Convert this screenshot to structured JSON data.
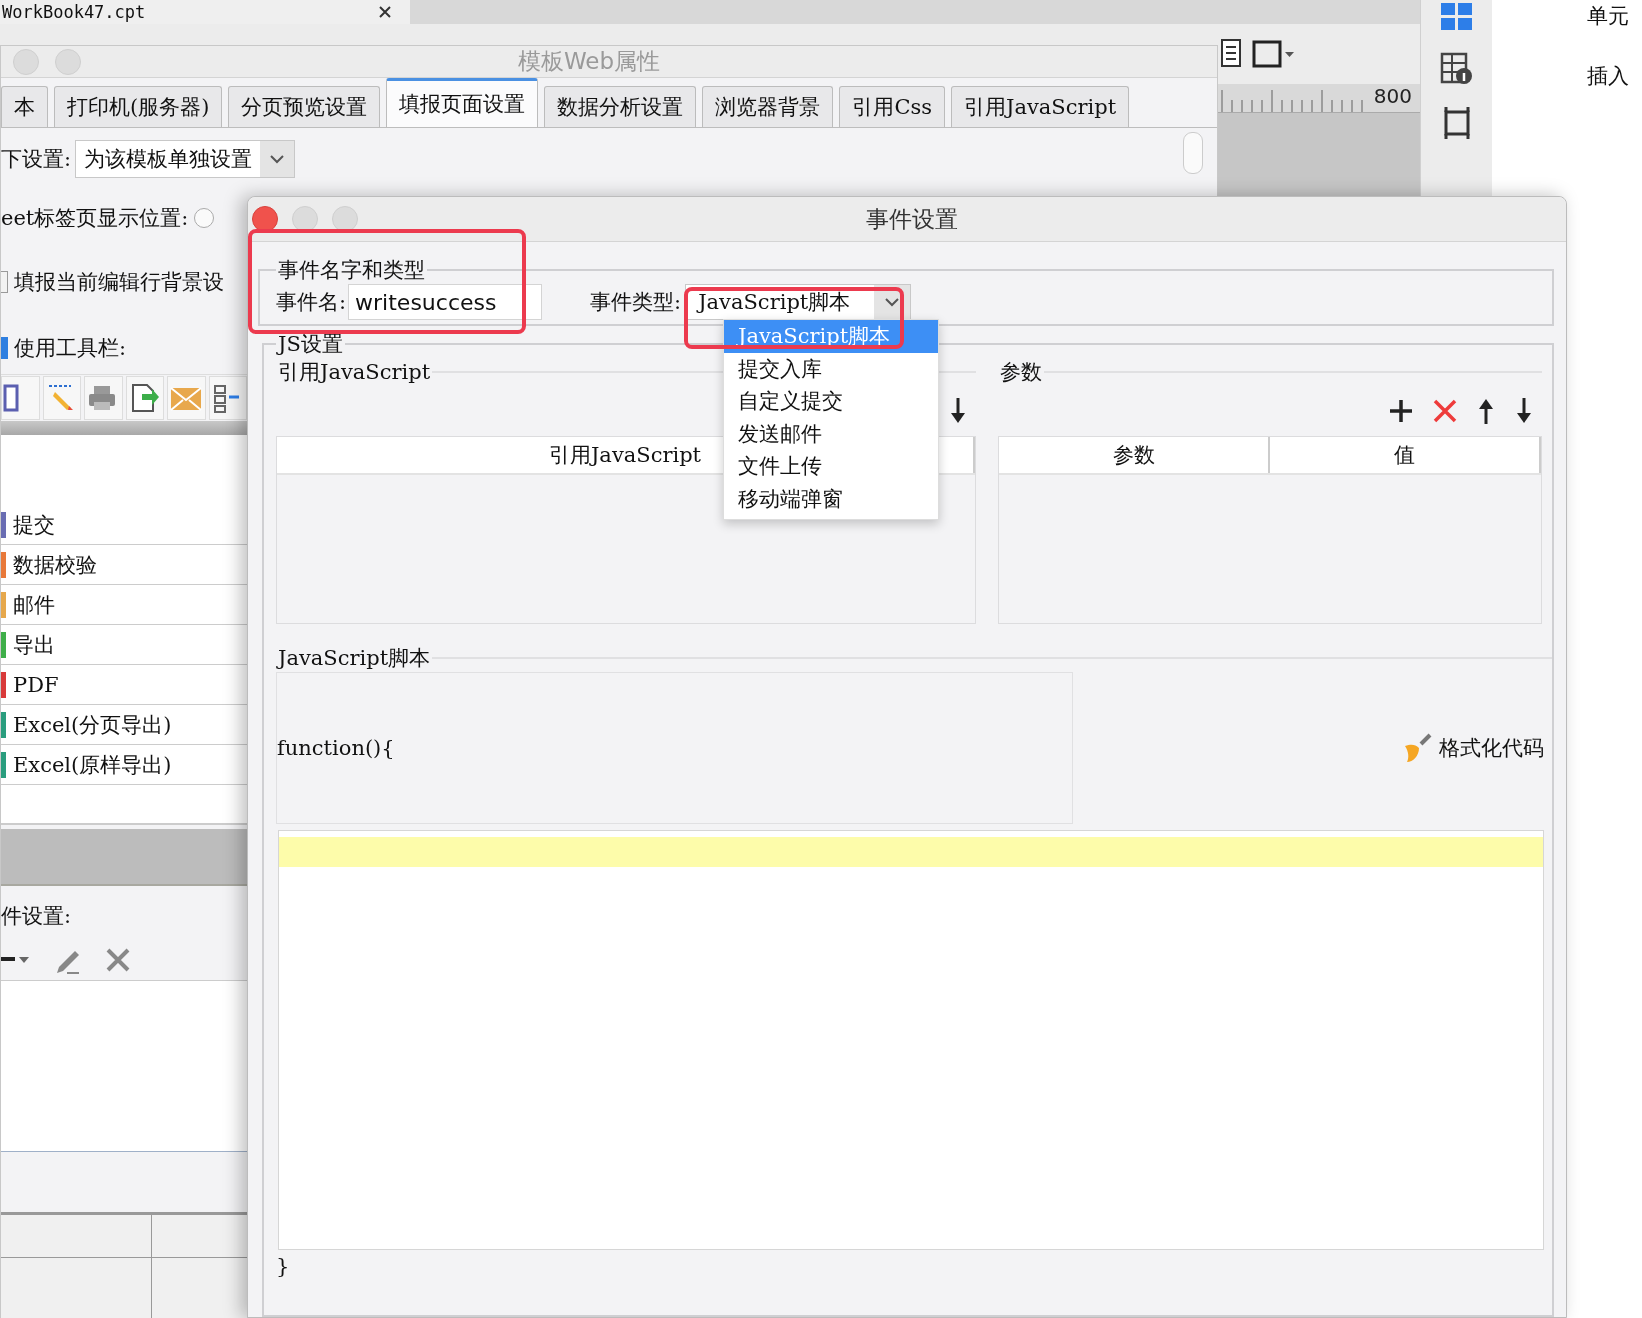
{
  "background_app": {
    "file_tab": "WorkBook47.cpt",
    "ruler_label": "800",
    "side_labels": [
      "单元",
      "插入"
    ]
  },
  "template_window": {
    "title": "模板Web属性",
    "tabs": [
      {
        "label": "本",
        "selected": false
      },
      {
        "label": "打印机(服务器)",
        "selected": false
      },
      {
        "label": "分页预览设置",
        "selected": false
      },
      {
        "label": "填报页面设置",
        "selected": true
      },
      {
        "label": "数据分析设置",
        "selected": false
      },
      {
        "label": "浏览器背景",
        "selected": false
      },
      {
        "label": "引用Css",
        "selected": false
      },
      {
        "label": "引用JavaScript",
        "selected": false
      }
    ],
    "scope": {
      "label": "下设置:",
      "value": "为该模板单独设置"
    },
    "sheet_tab_position": {
      "label": "eet标签页显示位置:",
      "selected": false
    },
    "row_background": {
      "label": "填报当前编辑行背景设",
      "checked": false
    },
    "toolbar": {
      "label": "使用工具栏:",
      "checked": true
    },
    "toolbar_items": [
      {
        "label": "提交",
        "color": "#6a6db3"
      },
      {
        "label": "数据校验",
        "color": "#e8793a"
      },
      {
        "label": "邮件",
        "color": "#e6a84c"
      },
      {
        "label": "导出",
        "color": "#3fae49"
      },
      {
        "label": "PDF",
        "color": "#d83a3a"
      },
      {
        "label": "Excel(分页导出)",
        "color": "#2a9d7e"
      },
      {
        "label": "Excel(原样导出)",
        "color": "#2a9d7e"
      }
    ],
    "event_settings": {
      "label": "件设置:"
    }
  },
  "event_dialog": {
    "title": "事件设置",
    "name_group": {
      "title": "事件名字和类型",
      "name_label": "事件名:",
      "name_value": "writesuccess",
      "type_label": "事件类型:",
      "type_value": "JavaScript脚本"
    },
    "type_menu": [
      {
        "label": "JavaScript脚本",
        "selected": true
      },
      {
        "label": "提交入库",
        "selected": false
      },
      {
        "label": "自定义提交",
        "selected": false
      },
      {
        "label": "发送邮件",
        "selected": false
      },
      {
        "label": "文件上传",
        "selected": false
      },
      {
        "label": "移动端弹窗",
        "selected": false
      }
    ],
    "js_group": {
      "title": "JS设置",
      "references": {
        "title": "引用JavaScript",
        "columns": [
          "引用JavaScript"
        ]
      },
      "parameters": {
        "title": "参数",
        "columns": [
          "参数",
          "值"
        ]
      },
      "script": {
        "title": "JavaScript脚本",
        "prefix": "function(){",
        "format_button": "格式化代码",
        "suffix": "}"
      }
    }
  }
}
